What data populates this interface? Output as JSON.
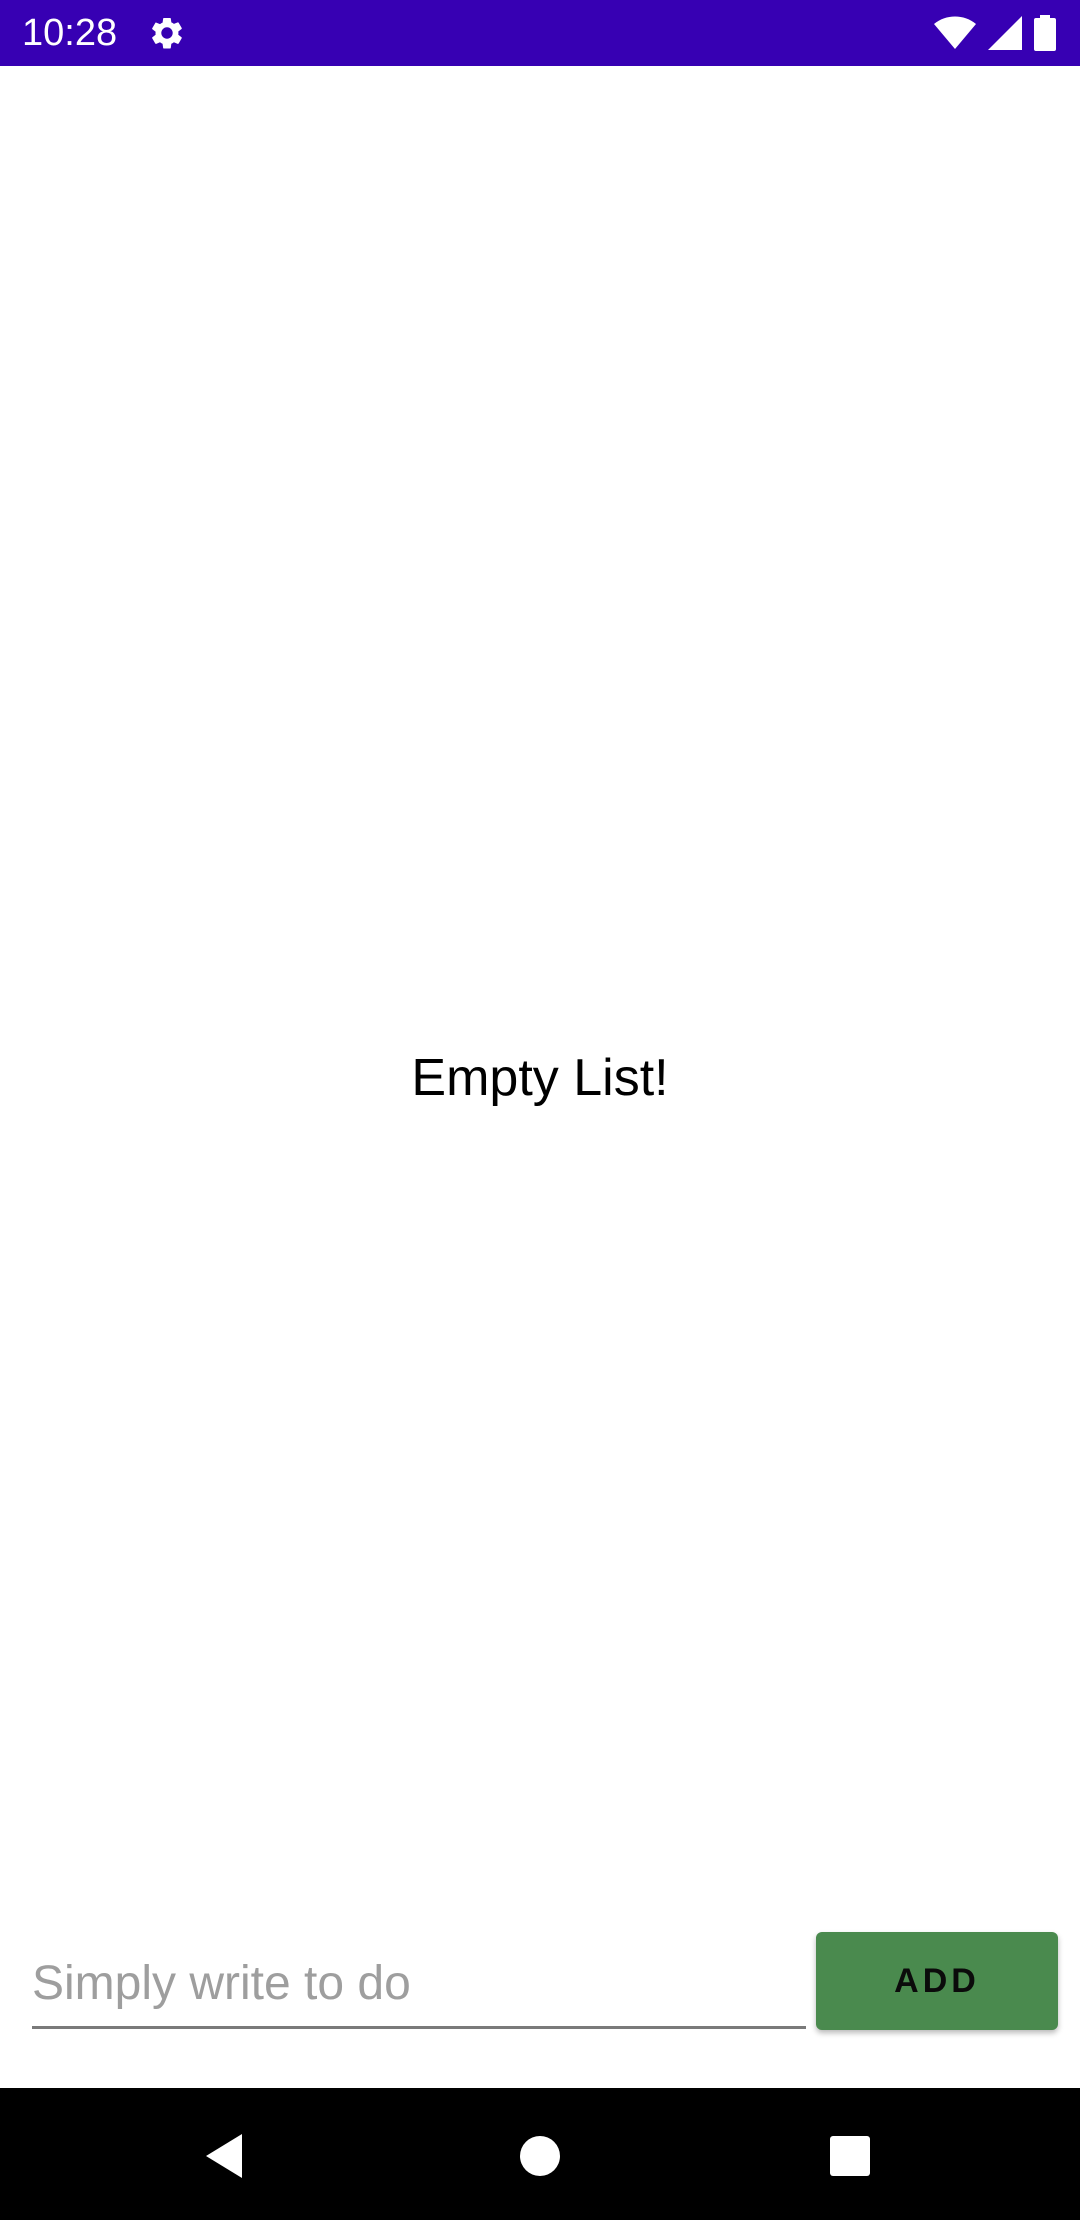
{
  "status_bar": {
    "time": "10:28",
    "background_color": "#3700b3",
    "icons": [
      "settings-icon",
      "wifi-icon",
      "cell-signal-icon",
      "battery-icon"
    ]
  },
  "main": {
    "empty_message": "Empty List!"
  },
  "todo_form": {
    "input_placeholder": "Simply write to do",
    "input_value": "",
    "add_label": "ADD",
    "add_button_color": "#4a8a4e"
  },
  "nav_bar": {
    "icons": [
      "back-icon",
      "home-icon",
      "recents-icon"
    ]
  }
}
